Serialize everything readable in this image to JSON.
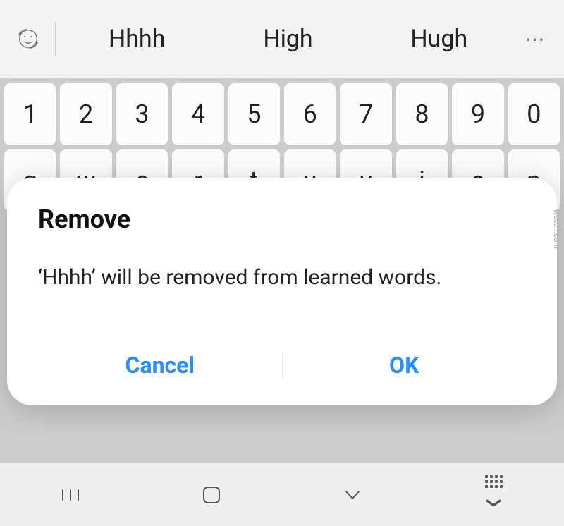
{
  "suggestions": {
    "s1": "Hhhh",
    "s2": "High",
    "s3": "Hugh"
  },
  "keys": {
    "num": {
      "k0": "1",
      "k1": "2",
      "k2": "3",
      "k3": "4",
      "k4": "5",
      "k5": "6",
      "k6": "7",
      "k7": "8",
      "k8": "9",
      "k9": "0"
    },
    "row1": {
      "k0": "q",
      "k1": "w",
      "k2": "e",
      "k3": "r",
      "k4": "t",
      "k5": "y",
      "k6": "u",
      "k7": "i",
      "k8": "o",
      "k9": "p"
    }
  },
  "dialog": {
    "title": "Remove",
    "message": "‘Hhhh’ will be removed from learned words.",
    "cancel": "Cancel",
    "ok": "OK"
  },
  "watermark": "wsxdn.com",
  "icons": {
    "emoji": "emoji-refresh-icon",
    "more": "⋯",
    "recents": "recents-icon",
    "home": "home-icon",
    "back": "back-icon",
    "hideKeyboard": "hide-keyboard-icon"
  }
}
